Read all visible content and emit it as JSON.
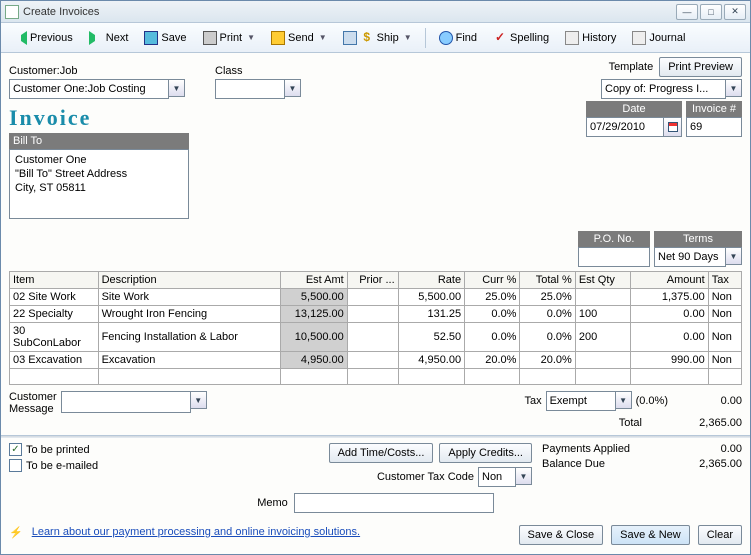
{
  "window": {
    "title": "Create Invoices"
  },
  "toolbar": {
    "previous": "Previous",
    "next": "Next",
    "save": "Save",
    "print": "Print",
    "send": "Send",
    "ship": "Ship",
    "find": "Find",
    "spelling": "Spelling",
    "history": "History",
    "journal": "Journal"
  },
  "top": {
    "customer_label": "Customer:Job",
    "customer_value": "Customer One:Job Costing",
    "class_label": "Class",
    "class_value": "",
    "template_label": "Template",
    "print_preview_label": "Print Preview",
    "template_value": "Copy of: Progress I..."
  },
  "invoice_heading": "Invoice",
  "billto": {
    "header": "Bill To",
    "line1": "Customer One",
    "line2": "\"Bill To\" Street Address",
    "line3": "City, ST 05811"
  },
  "date": {
    "label": "Date",
    "value": "07/29/2010"
  },
  "invno": {
    "label": "Invoice #",
    "value": "69"
  },
  "po": {
    "label": "P.O. No.",
    "value": ""
  },
  "terms": {
    "label": "Terms",
    "value": "Net 90 Days"
  },
  "cols": {
    "item": "Item",
    "desc": "Description",
    "est": "Est Amt",
    "prior": "Prior ...",
    "rate": "Rate",
    "curr": "Curr %",
    "totalp": "Total %",
    "estqty": "Est Qty",
    "amount": "Amount",
    "tax": "Tax"
  },
  "rows": [
    {
      "item": "02 Site Work",
      "desc": "Site Work",
      "est": "5,500.00",
      "prior": "",
      "rate": "5,500.00",
      "curr": "25.0%",
      "totalp": "25.0%",
      "estqty": "",
      "amount": "1,375.00",
      "tax": "Non",
      "estgray": true
    },
    {
      "item": "22 Specialty",
      "desc": "Wrought Iron Fencing",
      "est": "13,125.00",
      "prior": "",
      "rate": "131.25",
      "curr": "0.0%",
      "totalp": "0.0%",
      "estqty": "100",
      "amount": "0.00",
      "tax": "Non",
      "estgray": true
    },
    {
      "item": "30 SubConLabor",
      "desc": "Fencing Installation & Labor",
      "est": "10,500.00",
      "prior": "",
      "rate": "52.50",
      "curr": "0.0%",
      "totalp": "0.0%",
      "estqty": "200",
      "amount": "0.00",
      "tax": "Non",
      "estgray": true
    },
    {
      "item": "03 Excavation",
      "desc": "Excavation",
      "est": "4,950.00",
      "prior": "",
      "rate": "4,950.00",
      "curr": "20.0%",
      "totalp": "20.0%",
      "estqty": "",
      "amount": "990.00",
      "tax": "Non",
      "estgray": true
    }
  ],
  "cust_msg": {
    "label": "Customer\nMessage",
    "value": ""
  },
  "tax": {
    "label": "Tax",
    "value": "Exempt",
    "pct": "(0.0%)",
    "amount": "0.00"
  },
  "total": {
    "label": "Total",
    "value": "2,365.00"
  },
  "footer": {
    "to_be_printed": "To be printed",
    "to_be_emailed": "To be e-mailed",
    "add_time_costs": "Add Time/Costs...",
    "apply_credits": "Apply Credits...",
    "customer_tax_code_label": "Customer Tax Code",
    "customer_tax_code_value": "Non",
    "payments_applied_label": "Payments Applied",
    "payments_applied_value": "0.00",
    "balance_due_label": "Balance Due",
    "balance_due_value": "2,365.00",
    "memo_label": "Memo",
    "memo_value": "",
    "link_text": "Learn about our payment processing and online invoicing solutions.",
    "save_close": "Save & Close",
    "save_new": "Save & New",
    "clear": "Clear"
  }
}
